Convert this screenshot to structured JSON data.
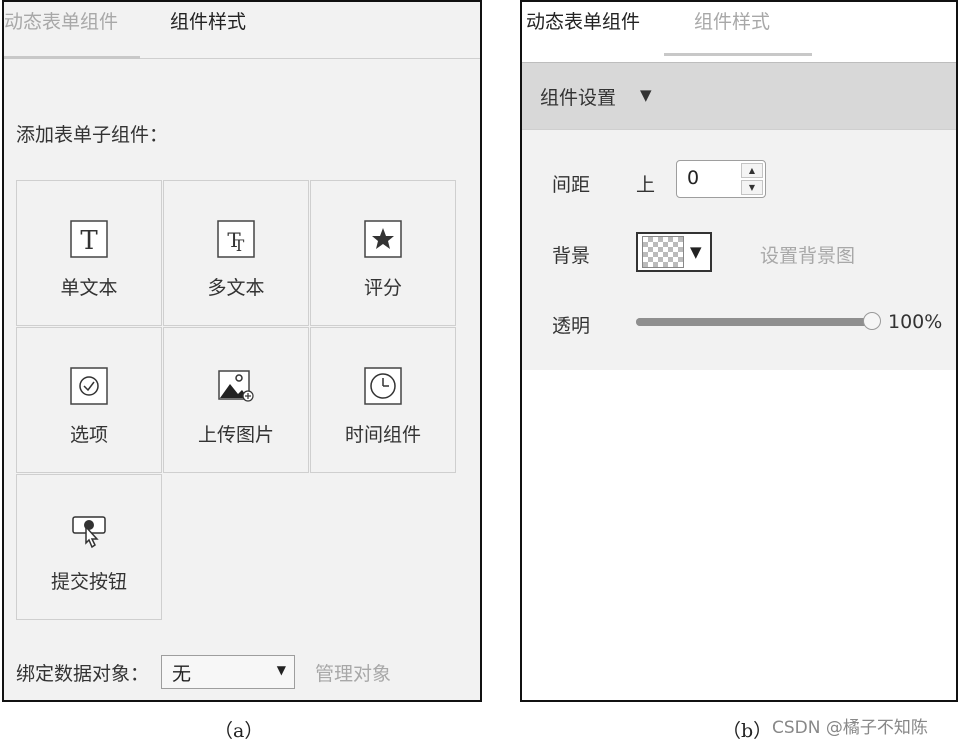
{
  "panel_a": {
    "tabs": [
      {
        "label": "动态表单组件",
        "active": false
      },
      {
        "label": "组件样式",
        "active": true
      }
    ],
    "section_label": "添加表单子组件：",
    "components": [
      {
        "label": "单文本",
        "icon": "single-text-icon"
      },
      {
        "label": "多文本",
        "icon": "multi-text-icon"
      },
      {
        "label": "评分",
        "icon": "rating-star-icon"
      },
      {
        "label": "选项",
        "icon": "option-check-icon"
      },
      {
        "label": "上传图片",
        "icon": "upload-image-icon"
      },
      {
        "label": "时间组件",
        "icon": "clock-icon"
      },
      {
        "label": "提交按钮",
        "icon": "submit-button-icon"
      }
    ],
    "bind_label": "绑定数据对象：",
    "bind_select_value": "无",
    "manage_link": "管理对象"
  },
  "panel_b": {
    "tabs": [
      {
        "label": "动态表单组件",
        "active": true
      },
      {
        "label": "组件样式",
        "active": false
      }
    ],
    "section_header": "组件设置",
    "spacing_label": "间距",
    "spacing_side": "上",
    "spacing_value": "0",
    "background_label": "背景",
    "background_link": "设置背景图",
    "opacity_label": "透明",
    "opacity_value_text": "100%",
    "opacity_fraction": 1.0
  },
  "captions": {
    "a": "（a）",
    "b": "（b）",
    "watermark": "CSDN @橘子不知陈"
  },
  "colors": {
    "panel_bg": "#f2f2f2",
    "header_bg": "#d8d8d8",
    "muted_text": "#a8a8a8"
  }
}
